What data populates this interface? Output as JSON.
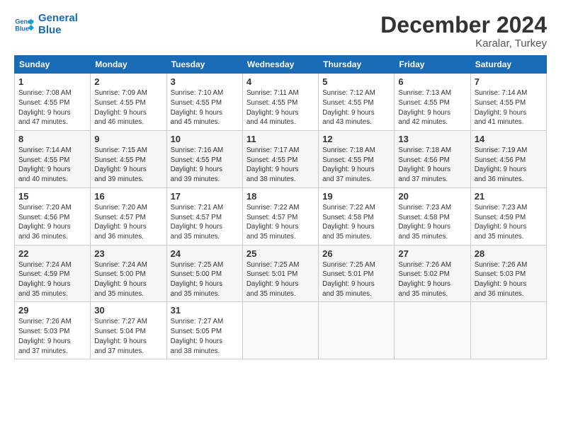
{
  "logo": {
    "line1": "General",
    "line2": "Blue"
  },
  "header": {
    "month_year": "December 2024",
    "location": "Karalar, Turkey"
  },
  "days_of_week": [
    "Sunday",
    "Monday",
    "Tuesday",
    "Wednesday",
    "Thursday",
    "Friday",
    "Saturday"
  ],
  "weeks": [
    [
      {
        "day": "1",
        "sunrise": "7:08 AM",
        "sunset": "4:55 PM",
        "daylight_hours": "9",
        "daylight_minutes": "47"
      },
      {
        "day": "2",
        "sunrise": "7:09 AM",
        "sunset": "4:55 PM",
        "daylight_hours": "9",
        "daylight_minutes": "46"
      },
      {
        "day": "3",
        "sunrise": "7:10 AM",
        "sunset": "4:55 PM",
        "daylight_hours": "9",
        "daylight_minutes": "45"
      },
      {
        "day": "4",
        "sunrise": "7:11 AM",
        "sunset": "4:55 PM",
        "daylight_hours": "9",
        "daylight_minutes": "44"
      },
      {
        "day": "5",
        "sunrise": "7:12 AM",
        "sunset": "4:55 PM",
        "daylight_hours": "9",
        "daylight_minutes": "43"
      },
      {
        "day": "6",
        "sunrise": "7:13 AM",
        "sunset": "4:55 PM",
        "daylight_hours": "9",
        "daylight_minutes": "42"
      },
      {
        "day": "7",
        "sunrise": "7:14 AM",
        "sunset": "4:55 PM",
        "daylight_hours": "9",
        "daylight_minutes": "41"
      }
    ],
    [
      {
        "day": "8",
        "sunrise": "7:14 AM",
        "sunset": "4:55 PM",
        "daylight_hours": "9",
        "daylight_minutes": "40"
      },
      {
        "day": "9",
        "sunrise": "7:15 AM",
        "sunset": "4:55 PM",
        "daylight_hours": "9",
        "daylight_minutes": "39"
      },
      {
        "day": "10",
        "sunrise": "7:16 AM",
        "sunset": "4:55 PM",
        "daylight_hours": "9",
        "daylight_minutes": "39"
      },
      {
        "day": "11",
        "sunrise": "7:17 AM",
        "sunset": "4:55 PM",
        "daylight_hours": "9",
        "daylight_minutes": "38"
      },
      {
        "day": "12",
        "sunrise": "7:18 AM",
        "sunset": "4:55 PM",
        "daylight_hours": "9",
        "daylight_minutes": "37"
      },
      {
        "day": "13",
        "sunrise": "7:18 AM",
        "sunset": "4:56 PM",
        "daylight_hours": "9",
        "daylight_minutes": "37"
      },
      {
        "day": "14",
        "sunrise": "7:19 AM",
        "sunset": "4:56 PM",
        "daylight_hours": "9",
        "daylight_minutes": "36"
      }
    ],
    [
      {
        "day": "15",
        "sunrise": "7:20 AM",
        "sunset": "4:56 PM",
        "daylight_hours": "9",
        "daylight_minutes": "36"
      },
      {
        "day": "16",
        "sunrise": "7:20 AM",
        "sunset": "4:57 PM",
        "daylight_hours": "9",
        "daylight_minutes": "36"
      },
      {
        "day": "17",
        "sunrise": "7:21 AM",
        "sunset": "4:57 PM",
        "daylight_hours": "9",
        "daylight_minutes": "35"
      },
      {
        "day": "18",
        "sunrise": "7:22 AM",
        "sunset": "4:57 PM",
        "daylight_hours": "9",
        "daylight_minutes": "35"
      },
      {
        "day": "19",
        "sunrise": "7:22 AM",
        "sunset": "4:58 PM",
        "daylight_hours": "9",
        "daylight_minutes": "35"
      },
      {
        "day": "20",
        "sunrise": "7:23 AM",
        "sunset": "4:58 PM",
        "daylight_hours": "9",
        "daylight_minutes": "35"
      },
      {
        "day": "21",
        "sunrise": "7:23 AM",
        "sunset": "4:59 PM",
        "daylight_hours": "9",
        "daylight_minutes": "35"
      }
    ],
    [
      {
        "day": "22",
        "sunrise": "7:24 AM",
        "sunset": "4:59 PM",
        "daylight_hours": "9",
        "daylight_minutes": "35"
      },
      {
        "day": "23",
        "sunrise": "7:24 AM",
        "sunset": "5:00 PM",
        "daylight_hours": "9",
        "daylight_minutes": "35"
      },
      {
        "day": "24",
        "sunrise": "7:25 AM",
        "sunset": "5:00 PM",
        "daylight_hours": "9",
        "daylight_minutes": "35"
      },
      {
        "day": "25",
        "sunrise": "7:25 AM",
        "sunset": "5:01 PM",
        "daylight_hours": "9",
        "daylight_minutes": "35"
      },
      {
        "day": "26",
        "sunrise": "7:25 AM",
        "sunset": "5:01 PM",
        "daylight_hours": "9",
        "daylight_minutes": "35"
      },
      {
        "day": "27",
        "sunrise": "7:26 AM",
        "sunset": "5:02 PM",
        "daylight_hours": "9",
        "daylight_minutes": "35"
      },
      {
        "day": "28",
        "sunrise": "7:26 AM",
        "sunset": "5:03 PM",
        "daylight_hours": "9",
        "daylight_minutes": "36"
      }
    ],
    [
      {
        "day": "29",
        "sunrise": "7:26 AM",
        "sunset": "5:03 PM",
        "daylight_hours": "9",
        "daylight_minutes": "37"
      },
      {
        "day": "30",
        "sunrise": "7:27 AM",
        "sunset": "5:04 PM",
        "daylight_hours": "9",
        "daylight_minutes": "37"
      },
      {
        "day": "31",
        "sunrise": "7:27 AM",
        "sunset": "5:05 PM",
        "daylight_hours": "9",
        "daylight_minutes": "38"
      },
      null,
      null,
      null,
      null
    ]
  ]
}
